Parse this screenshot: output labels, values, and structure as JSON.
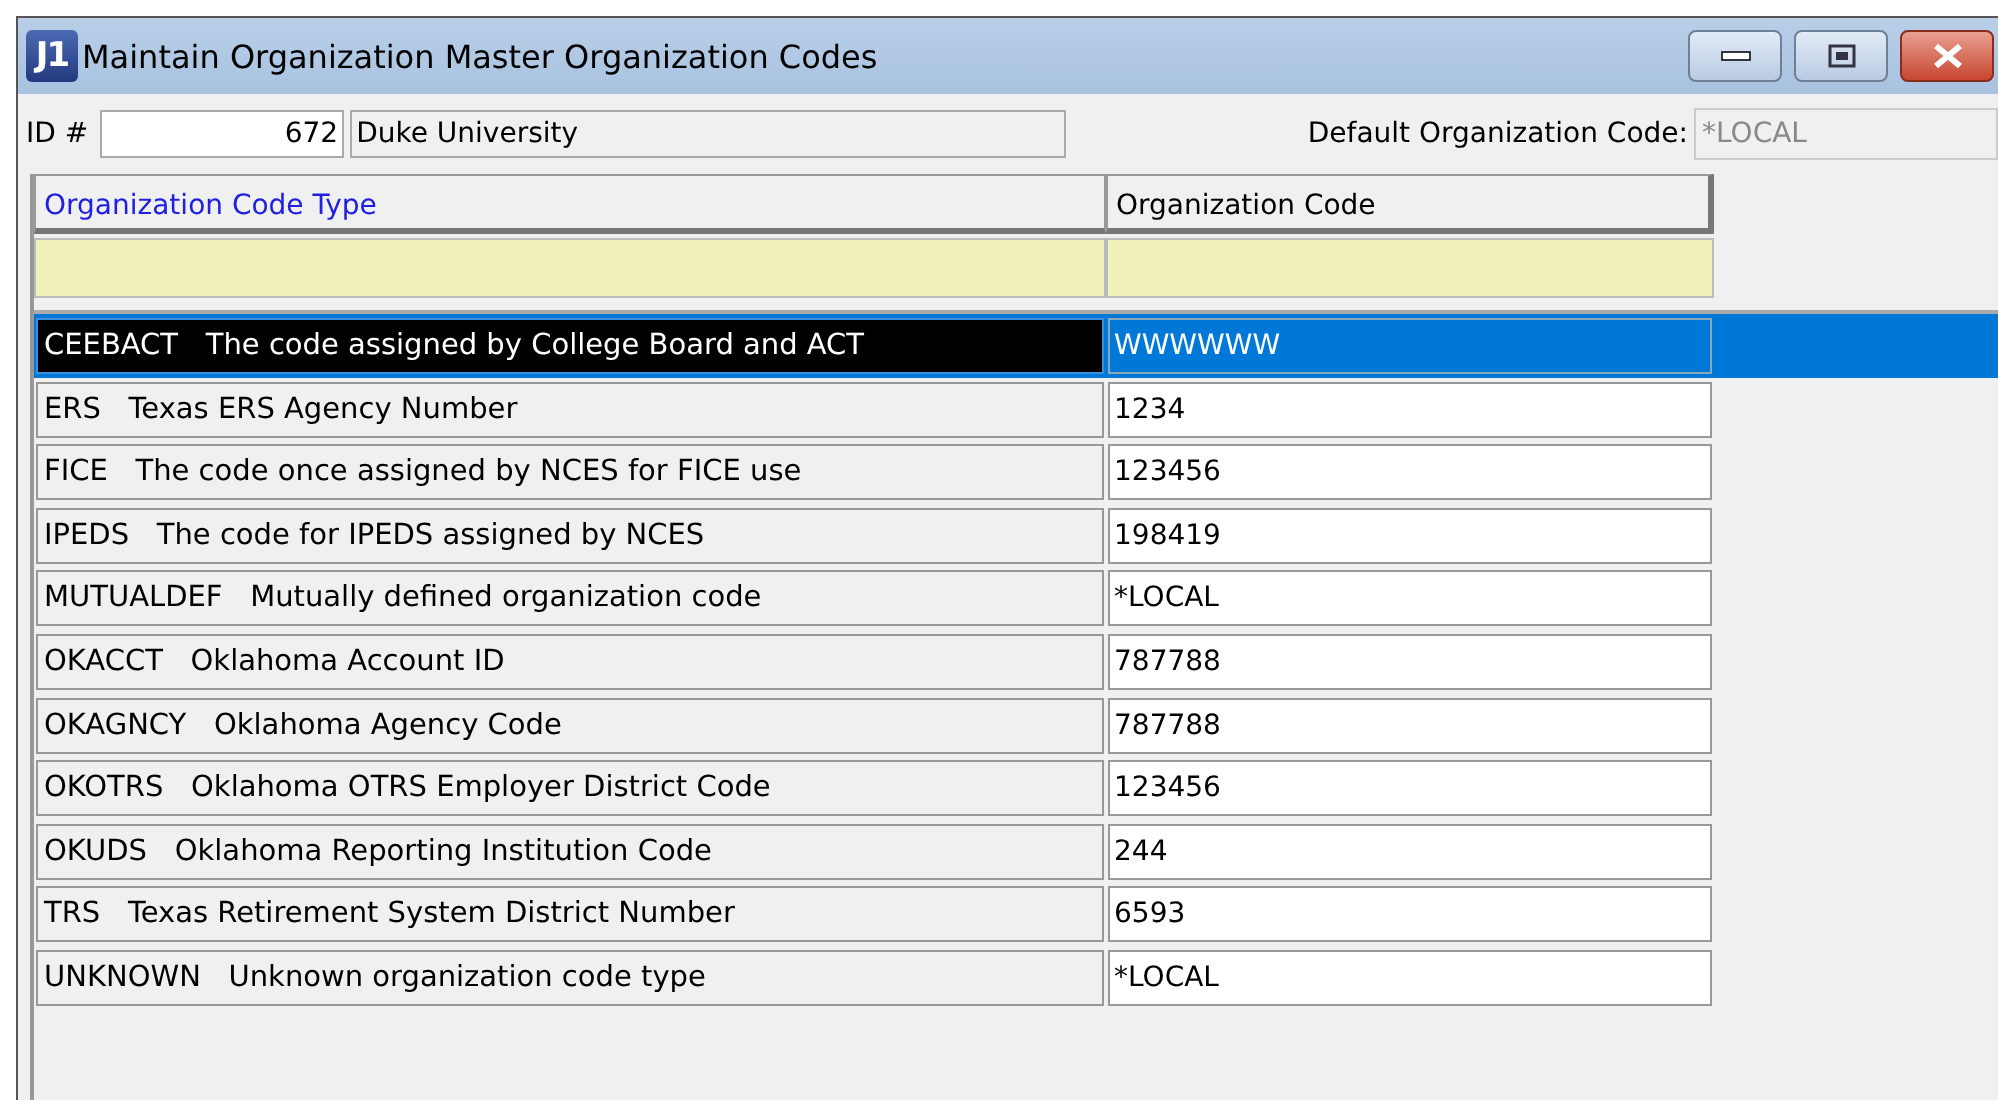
{
  "window": {
    "title": "Maintain Organization Master Organization Codes",
    "app_icon": "J1"
  },
  "header": {
    "id_label": "ID #",
    "id_value": "672",
    "name_value": "Duke University",
    "default_label": "Default Organization Code:",
    "default_value": "*LOCAL"
  },
  "table": {
    "columns": [
      {
        "label": "Organization Code Type",
        "sortable": true
      },
      {
        "label": "Organization Code",
        "sortable": false
      }
    ],
    "rows": [
      {
        "type": "CEEBACT   The code assigned by College Board and ACT",
        "code": "WWWWWW",
        "selected": true
      },
      {
        "type": "ERS   Texas ERS Agency Number",
        "code": "1234",
        "selected": false
      },
      {
        "type": "FICE   The code once assigned by NCES for FICE use",
        "code": "123456",
        "selected": false
      },
      {
        "type": "IPEDS   The code for IPEDS assigned by NCES",
        "code": "198419",
        "selected": false
      },
      {
        "type": "MUTUALDEF   Mutually defined organization code",
        "code": "*LOCAL",
        "selected": false
      },
      {
        "type": "OKACCT   Oklahoma Account ID",
        "code": "787788",
        "selected": false
      },
      {
        "type": "OKAGNCY   Oklahoma Agency Code",
        "code": "787788",
        "selected": false
      },
      {
        "type": "OKOTRS   Oklahoma OTRS Employer District Code",
        "code": "123456",
        "selected": false
      },
      {
        "type": "OKUDS   Oklahoma Reporting Institution Code",
        "code": "244",
        "selected": false
      },
      {
        "type": "TRS   Texas Retirement System District Number",
        "code": "6593",
        "selected": false
      },
      {
        "type": "UNKNOWN   Unknown organization code type",
        "code": "*LOCAL",
        "selected": false
      }
    ]
  }
}
